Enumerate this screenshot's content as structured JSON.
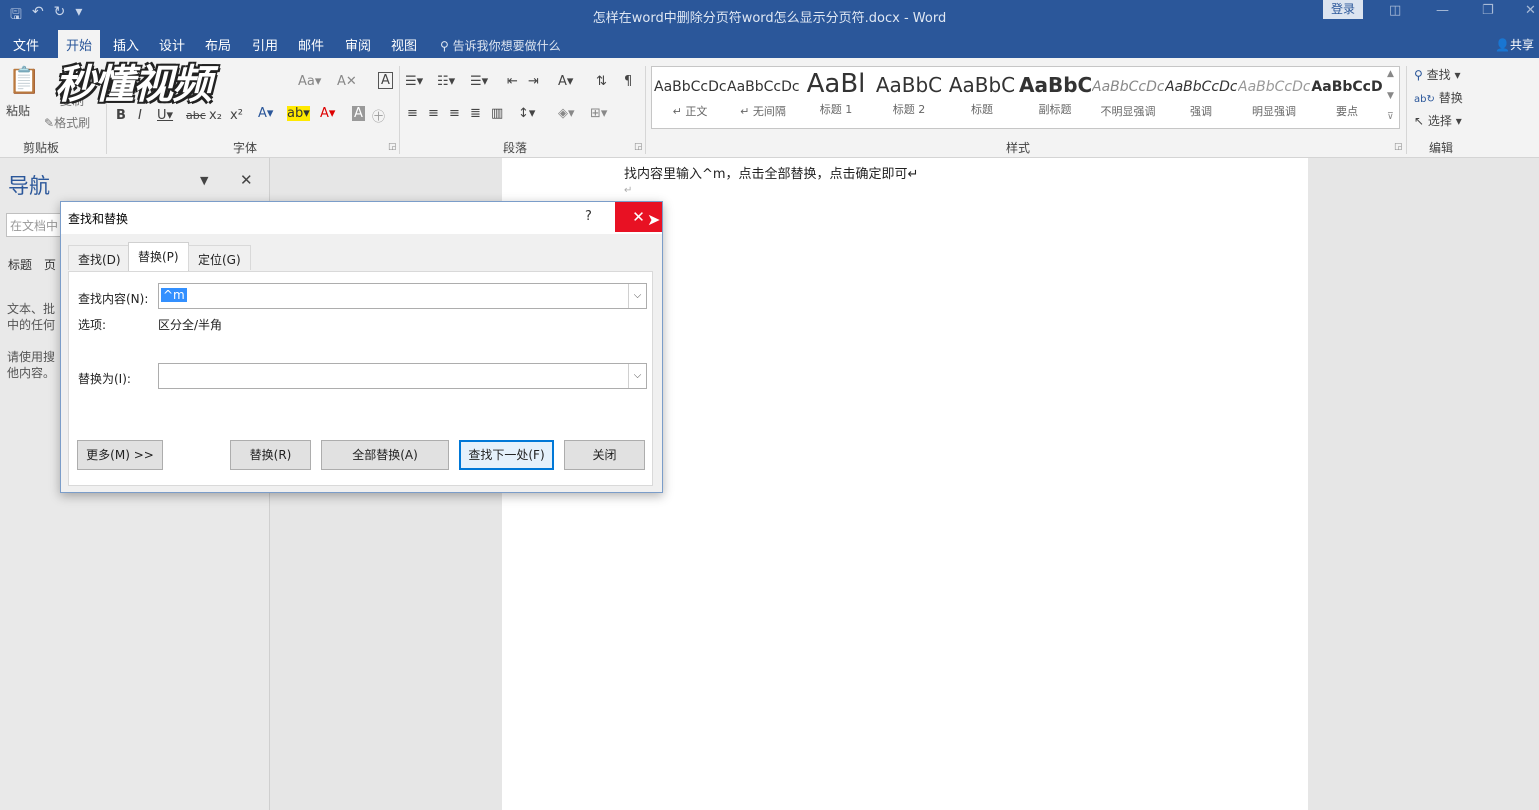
{
  "titlebar": {
    "doc_title": "怎样在word中删除分页符word怎么显示分页符.docx - Word",
    "login": "登录",
    "qat_icons": [
      "save-icon",
      "undo-icon",
      "redo-icon",
      "customize-icon"
    ]
  },
  "menu": {
    "tabs": [
      "文件",
      "开始",
      "插入",
      "设计",
      "布局",
      "引用",
      "邮件",
      "审阅",
      "视图"
    ],
    "active_tab": "开始",
    "tell_me": "告诉我你想要做什么",
    "share": "共享"
  },
  "ribbon": {
    "clipboard": {
      "label": "剪贴板",
      "paste": "粘贴",
      "copy": "复制",
      "format_painter": "格式刷"
    },
    "font": {
      "label": "字体"
    },
    "paragraph": {
      "label": "段落"
    },
    "styles": {
      "label": "样式",
      "items": [
        {
          "preview": "AaBbCcDc",
          "name": "↵ 正文"
        },
        {
          "preview": "AaBbCcDc",
          "name": "↵ 无间隔"
        },
        {
          "preview": "AaBl",
          "name": "标题 1"
        },
        {
          "preview": "AaBbC",
          "name": "标题 2"
        },
        {
          "preview": "AaBbC",
          "name": "标题"
        },
        {
          "preview": "AaBbC",
          "name": "副标题"
        },
        {
          "preview": "AaBbCcDc",
          "name": "不明显强调"
        },
        {
          "preview": "AaBbCcDc",
          "name": "强调"
        },
        {
          "preview": "AaBbCcDc",
          "name": "明显强调"
        },
        {
          "preview": "AaBbCcD",
          "name": "要点"
        }
      ]
    },
    "editing": {
      "label": "编辑",
      "find": "查找",
      "replace": "替换",
      "select": "选择"
    }
  },
  "watermark": "秒懂视频",
  "nav": {
    "title": "导航",
    "search_placeholder": "在文档中",
    "tabs": "标题　页",
    "text1a": "文本、批",
    "text1b": "中的任何",
    "text2a": "请使用搜",
    "text2b": "他内容。"
  },
  "document": {
    "line1": "找内容里输入^m，点击全部替换，点击确定即可↵",
    "pilcrow": "↵"
  },
  "dialog": {
    "title": "查找和替换",
    "help": "?",
    "tabs": {
      "find": "查找(D)",
      "replace": "替换(P)",
      "goto": "定位(G)"
    },
    "find_label": "查找内容(N):",
    "find_value": "^m",
    "options_label": "选项:",
    "options_value": "区分全/半角",
    "replace_label": "替换为(I):",
    "replace_value": "",
    "buttons": {
      "more": "更多(M) >>",
      "replace": "替换(R)",
      "replace_all": "全部替换(A)",
      "find_next": "查找下一处(F)",
      "close": "关闭"
    }
  }
}
